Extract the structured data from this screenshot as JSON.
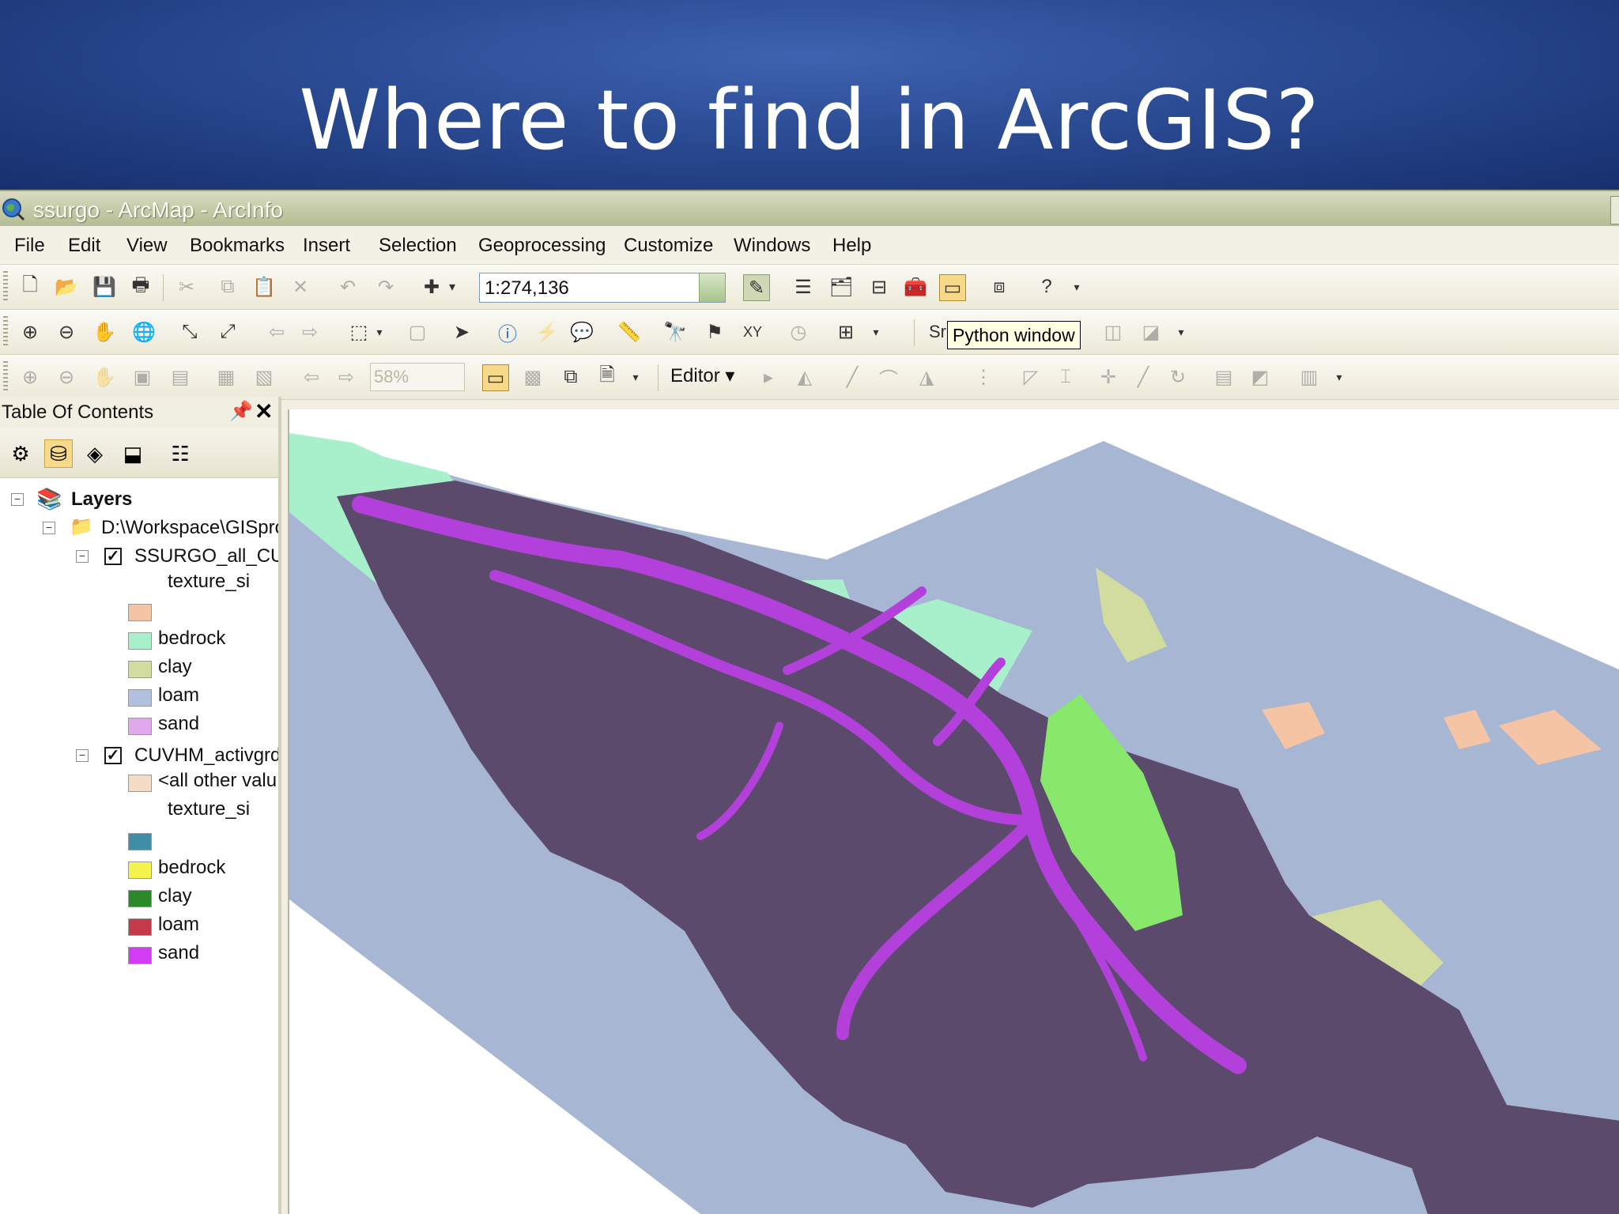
{
  "slide": {
    "title": "Where to find in ArcGIS?"
  },
  "window": {
    "title": "ssurgo - ArcMap - ArcInfo"
  },
  "menu": [
    "File",
    "Edit",
    "View",
    "Bookmarks",
    "Insert",
    "Selection",
    "Geoprocessing",
    "Customize",
    "Windows",
    "Help"
  ],
  "toolbar": {
    "scale_value": "1:274,136",
    "tooltip": "Python window",
    "snapping_partial": "Sr",
    "zoom_value": "58%",
    "editor_label": "Editor"
  },
  "toc": {
    "title": "Table Of Contents",
    "layers_label": "Layers",
    "workspace": "D:\\Workspace\\GISpro",
    "layer1": {
      "name": "SSURGO_all_CUV",
      "field": "texture_si",
      "classes": [
        {
          "label": "",
          "color": "#f4c4a4"
        },
        {
          "label": "bedrock",
          "color": "#a8f0cc"
        },
        {
          "label": "clay",
          "color": "#d2dc9e"
        },
        {
          "label": "loam",
          "color": "#b0c0de"
        },
        {
          "label": "sand",
          "color": "#e2a8ee"
        }
      ]
    },
    "layer2": {
      "name": "CUVHM_activgrd_",
      "other_values": "<all other valu",
      "other_color": "#f4dcc6",
      "field": "texture_si",
      "classes": [
        {
          "label": "",
          "color": "#3f8ea6"
        },
        {
          "label": "bedrock",
          "color": "#f4f44c"
        },
        {
          "label": "clay",
          "color": "#2a8a2a"
        },
        {
          "label": "loam",
          "color": "#c43a4a"
        },
        {
          "label": "sand",
          "color": "#d23cf2"
        }
      ]
    }
  },
  "map_colors": {
    "loam_background": "#a7b6d2",
    "bedrock_area": "#a8f0cc",
    "clay_area": "#d2dc9e",
    "texture_blank": "#f4c4a4",
    "grid_dark": "#5c4a6c",
    "grid_sand": "#b440dc",
    "grid_green": "#88e86c"
  }
}
